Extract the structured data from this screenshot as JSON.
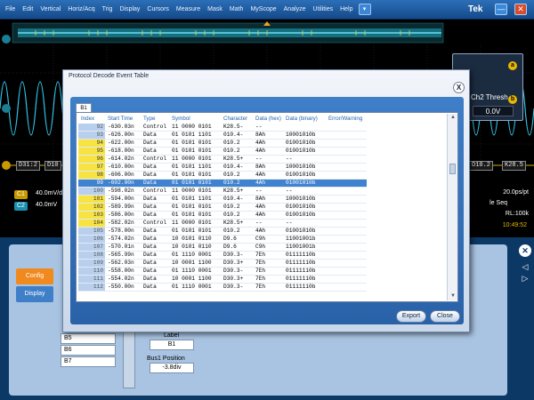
{
  "menu": {
    "items": [
      "File",
      "Edit",
      "Vertical",
      "Horiz/Acq",
      "Trig",
      "Display",
      "Cursors",
      "Measure",
      "Mask",
      "Math",
      "MyScope",
      "Analyze",
      "Utilities",
      "Help"
    ],
    "dropdown_icon": "▾",
    "brand": "Tek",
    "min_icon": "—",
    "close_icon": "✕"
  },
  "scope": {
    "bus_labels": [
      "D31:2",
      "D10",
      "D10.2",
      "K28.5"
    ],
    "marker_2": "2",
    "marker_b": "B"
  },
  "thresh_panel": {
    "title": "Ch2 Thresh",
    "value": "0.0V",
    "circle_a": "a",
    "circle_b": "b"
  },
  "readouts": {
    "ch1_badge": "C1",
    "ch1_value": "40.0mV/div",
    "ch2_badge": "C2",
    "ch2_value": "40.0mV",
    "sample": "20.0ps/pt",
    "seq": "le Seq",
    "rl": "RL:100k",
    "time": "10:49:52"
  },
  "dialog": {
    "title": "Protocol Decode Event Table",
    "close_icon": "X",
    "tab": "B1",
    "columns": [
      "Index",
      "Start Time",
      "Type",
      "Symbol",
      "Character",
      "Data (hex)",
      "Data (binary)",
      "Error/Warning"
    ],
    "rows": [
      {
        "index": "92",
        "start": "-630.03n",
        "type": "Control",
        "symbol": "11 0000 0101",
        "char": "K28.5-",
        "hex": "--",
        "bin": "",
        "err": ""
      },
      {
        "index": "93",
        "start": "-626.00n",
        "type": "Data",
        "symbol": "01 0101 1101",
        "char": "010.4-",
        "hex": "8Ah",
        "bin": "10001010b",
        "err": ""
      },
      {
        "index": "94",
        "start": "-622.00n",
        "type": "Data",
        "symbol": "01 0101 0101",
        "char": "010.2",
        "hex": "4Ah",
        "bin": "01001010b",
        "err": ""
      },
      {
        "index": "95",
        "start": "-618.00n",
        "type": "Data",
        "symbol": "01 0101 0101",
        "char": "010.2",
        "hex": "4Ah",
        "bin": "01001010b",
        "err": ""
      },
      {
        "index": "96",
        "start": "-614.02n",
        "type": "Control",
        "symbol": "11 0000 0101",
        "char": "K28.5+",
        "hex": "--",
        "bin": "--",
        "err": ""
      },
      {
        "index": "97",
        "start": "-610.00n",
        "type": "Data",
        "symbol": "01 0101 1101",
        "char": "010.4-",
        "hex": "8Ah",
        "bin": "10001010b",
        "err": ""
      },
      {
        "index": "98",
        "start": "-606.00n",
        "type": "Data",
        "symbol": "01 0101 0101",
        "char": "010.2",
        "hex": "4Ah",
        "bin": "01001010b",
        "err": ""
      },
      {
        "index": "99",
        "start": "-602.00n",
        "type": "Data",
        "symbol": "01 0101 0101",
        "char": "010.2",
        "hex": "4Ah",
        "bin": "01001010b",
        "err": ""
      },
      {
        "index": "100",
        "start": "-598.02n",
        "type": "Control",
        "symbol": "11 0000 0101",
        "char": "K28.5+",
        "hex": "--",
        "bin": "--",
        "err": ""
      },
      {
        "index": "101",
        "start": "-594.00n",
        "type": "Data",
        "symbol": "01 0101 1101",
        "char": "010.4-",
        "hex": "8Ah",
        "bin": "10001010b",
        "err": ""
      },
      {
        "index": "102",
        "start": "-589.99n",
        "type": "Data",
        "symbol": "01 0101 0101",
        "char": "010.2",
        "hex": "4Ah",
        "bin": "01001010b",
        "err": ""
      },
      {
        "index": "103",
        "start": "-586.00n",
        "type": "Data",
        "symbol": "01 0101 0101",
        "char": "010.2",
        "hex": "4Ah",
        "bin": "01001010b",
        "err": ""
      },
      {
        "index": "104",
        "start": "-582.02n",
        "type": "Control",
        "symbol": "11 0000 0101",
        "char": "K28.5+",
        "hex": "--",
        "bin": "--",
        "err": ""
      },
      {
        "index": "105",
        "start": "-578.00n",
        "type": "Data",
        "symbol": "01 0101 0101",
        "char": "010.2",
        "hex": "4Ah",
        "bin": "01001010b",
        "err": ""
      },
      {
        "index": "106",
        "start": "-574.02n",
        "type": "Data",
        "symbol": "10 0101 0110",
        "char": "D9.6",
        "hex": "C9h",
        "bin": "11001001b",
        "err": ""
      },
      {
        "index": "107",
        "start": "-570.01n",
        "type": "Data",
        "symbol": "10 0101 0110",
        "char": "D9.6",
        "hex": "C9h",
        "bin": "11001001b",
        "err": ""
      },
      {
        "index": "108",
        "start": "-565.99n",
        "type": "Data",
        "symbol": "01 1110 0001",
        "char": "D30.3-",
        "hex": "7Eh",
        "bin": "01111110b",
        "err": ""
      },
      {
        "index": "109",
        "start": "-562.03n",
        "type": "Data",
        "symbol": "10 0001 1100",
        "char": "D30.3+",
        "hex": "7Eh",
        "bin": "01111110b",
        "err": ""
      },
      {
        "index": "110",
        "start": "-558.00n",
        "type": "Data",
        "symbol": "01 1110 0001",
        "char": "D30.3-",
        "hex": "7Eh",
        "bin": "01111110b",
        "err": ""
      },
      {
        "index": "111",
        "start": "-554.02n",
        "type": "Data",
        "symbol": "10 0001 1100",
        "char": "D30.3+",
        "hex": "7Eh",
        "bin": "01111110b",
        "err": ""
      },
      {
        "index": "112",
        "start": "-550.00n",
        "type": "Data",
        "symbol": "01 1110 0001",
        "char": "D30.3-",
        "hex": "7Eh",
        "bin": "01111110b",
        "err": ""
      }
    ],
    "selected_index": "99",
    "highlight_indices": [
      "94",
      "95",
      "96",
      "97",
      "98",
      "99",
      "101",
      "102",
      "103",
      "104"
    ],
    "export_label": "Export",
    "close_label": "Close"
  },
  "lower": {
    "config_tab": "Config",
    "display_tab": "Display",
    "list_items": [
      "B5",
      "B6",
      "B7"
    ],
    "label_caption": "Label",
    "label_value": "B1",
    "position_caption": "Bus1 Position",
    "position_value": "-3.8div",
    "nav_close": "✕"
  },
  "colors": {
    "menu_bar": "#1e5ca3",
    "selected_row": "#3f82cf",
    "highlight": "#f7e342",
    "config_tab": "#f08a1e",
    "display_tab": "#3f7fc8",
    "ch1": "#e8b800",
    "ch2": "#27b0d8"
  }
}
